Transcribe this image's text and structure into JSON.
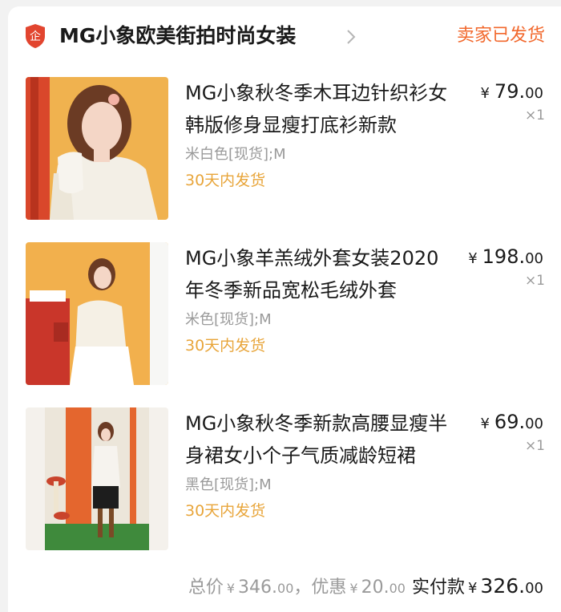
{
  "shop": {
    "name": "MG小象欧美街拍时尚女装",
    "badge_icon": "enterprise-shield-icon",
    "badge_text": "企",
    "status": "卖家已发货",
    "accent": "#f2692e"
  },
  "items": [
    {
      "title": "MG小象秋冬季木耳边针织衫女韩版修身显瘦打底衫新款",
      "sku": "米白色[现货];M",
      "ship": "30天内发货",
      "currency": "¥",
      "price_int": "79.",
      "price_dec": "00",
      "qty": "×1"
    },
    {
      "title": "MG小象羊羔绒外套女装2020年冬季新品宽松毛绒外套",
      "sku": "米色[现货];M",
      "ship": "30天内发货",
      "currency": "¥",
      "price_int": "198.",
      "price_dec": "00",
      "qty": "×1"
    },
    {
      "title": "MG小象秋冬季新款高腰显瘦半身裙女小个子气质减龄短裙",
      "sku": "黑色[现货];M",
      "ship": "30天内发货",
      "currency": "¥",
      "price_int": "69.",
      "price_dec": "00",
      "qty": "×1"
    }
  ],
  "summary": {
    "total_label": "总价",
    "currency": "¥",
    "total_int": "346.",
    "total_dec": "00",
    "sep": "，",
    "discount_label": "优惠",
    "discount_int": "20.",
    "discount_dec": "00",
    "paid_label": "实付款",
    "paid_int": "326.",
    "paid_dec": "00"
  }
}
